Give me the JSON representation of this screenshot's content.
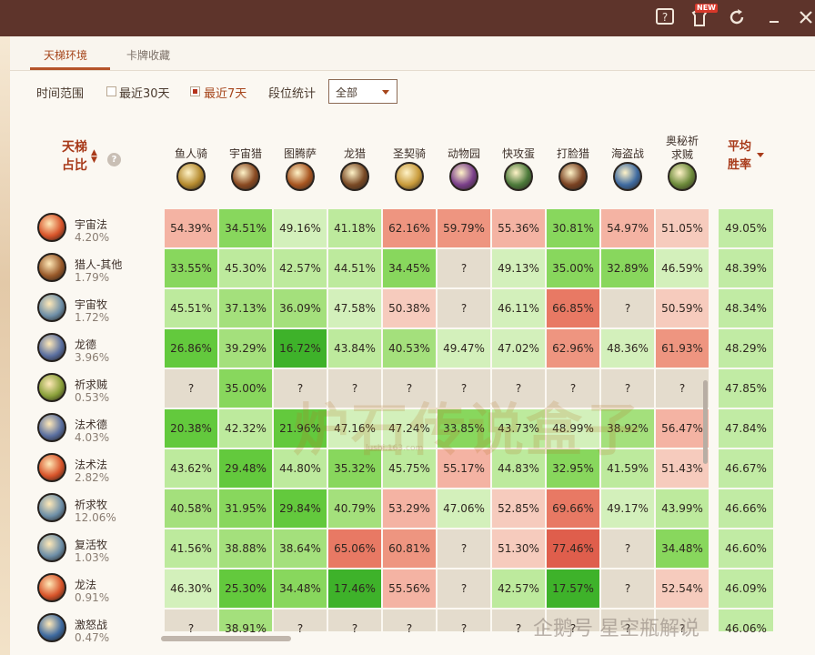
{
  "window": {
    "new_badge": "NEW",
    "icons": [
      "help-icon",
      "gift-icon",
      "refresh-icon",
      "minimize-icon",
      "close-icon"
    ]
  },
  "tabs": [
    {
      "label": "天梯环境",
      "active": true
    },
    {
      "label": "卡牌收藏",
      "active": false
    }
  ],
  "filters": {
    "time_range_label": "时间范围",
    "option_30": "最近30天",
    "option_7": "最近7天",
    "rank_label": "段位统计",
    "rank_value": "全部"
  },
  "table": {
    "left_header": "天梯占比",
    "avg_header": "平均胜率",
    "columns": [
      {
        "name": "鱼人骑",
        "color": "#b58a2e"
      },
      {
        "name": "宇宙猎",
        "color": "#8a4a22"
      },
      {
        "name": "图腾萨",
        "color": "#a85520"
      },
      {
        "name": "龙猎",
        "color": "#7a4a25"
      },
      {
        "name": "圣契骑",
        "color": "#c89a3a"
      },
      {
        "name": "动物园",
        "color": "#7a3f8a"
      },
      {
        "name": "快攻蛋",
        "color": "#4c7a3a"
      },
      {
        "name": "打脸猎",
        "color": "#7a4222"
      },
      {
        "name": "海盗战",
        "color": "#3e6aa0"
      },
      {
        "name": "奥秘祈求贼",
        "color": "#6c8a3a"
      }
    ],
    "rows": [
      {
        "name": "宇宙法",
        "share": "4.20%",
        "icon": "mage-icon",
        "color": "#d8542a",
        "cells": [
          "54.39%",
          "34.51%",
          "49.16%",
          "41.18%",
          "62.16%",
          "59.79%",
          "55.36%",
          "30.81%",
          "54.97%",
          "51.05%"
        ],
        "avg": "49.05%"
      },
      {
        "name": "猎人-其他",
        "share": "1.79%",
        "icon": "hunter-icon",
        "color": "#9a5a2a",
        "cells": [
          "33.55%",
          "45.30%",
          "42.57%",
          "44.51%",
          "34.45%",
          "?",
          "49.13%",
          "35.00%",
          "32.89%",
          "46.59%"
        ],
        "avg": "48.39%"
      },
      {
        "name": "宇宙牧",
        "share": "1.72%",
        "icon": "priest-icon",
        "color": "#6e8fa8",
        "cells": [
          "45.51%",
          "37.13%",
          "36.09%",
          "47.58%",
          "50.38%",
          "?",
          "46.11%",
          "66.85%",
          "?",
          "50.59%"
        ],
        "avg": "48.34%"
      },
      {
        "name": "龙德",
        "share": "3.96%",
        "icon": "druid-icon",
        "color": "#5a6fa0",
        "cells": [
          "26.86%",
          "39.29%",
          "16.72%",
          "43.84%",
          "40.53%",
          "49.47%",
          "47.02%",
          "62.96%",
          "48.36%",
          "61.93%"
        ],
        "avg": "48.29%"
      },
      {
        "name": "祈求贼",
        "share": "0.53%",
        "icon": "rogue-icon",
        "color": "#8aa03a",
        "cells": [
          "?",
          "35.00%",
          "?",
          "?",
          "?",
          "?",
          "?",
          "?",
          "?",
          "?"
        ],
        "avg": "47.85%"
      },
      {
        "name": "法术德",
        "share": "4.03%",
        "icon": "druid-icon",
        "color": "#5a6fa0",
        "cells": [
          "20.38%",
          "42.32%",
          "21.96%",
          "47.16%",
          "47.24%",
          "33.85%",
          "43.73%",
          "48.99%",
          "38.92%",
          "56.47%"
        ],
        "avg": "47.84%"
      },
      {
        "name": "法术法",
        "share": "2.82%",
        "icon": "mage-icon",
        "color": "#d8542a",
        "cells": [
          "43.62%",
          "29.48%",
          "44.80%",
          "35.32%",
          "45.75%",
          "55.17%",
          "44.83%",
          "32.95%",
          "41.59%",
          "51.43%"
        ],
        "avg": "46.67%"
      },
      {
        "name": "祈求牧",
        "share": "12.06%",
        "icon": "priest-icon",
        "color": "#6e8fa8",
        "cells": [
          "40.58%",
          "31.95%",
          "29.84%",
          "40.79%",
          "53.29%",
          "47.06%",
          "52.85%",
          "69.66%",
          "49.17%",
          "43.99%"
        ],
        "avg": "46.66%"
      },
      {
        "name": "复活牧",
        "share": "1.03%",
        "icon": "priest-icon",
        "color": "#6e8fa8",
        "cells": [
          "41.56%",
          "38.88%",
          "38.64%",
          "65.06%",
          "60.81%",
          "?",
          "51.30%",
          "77.46%",
          "?",
          "34.48%"
        ],
        "avg": "46.60%"
      },
      {
        "name": "龙法",
        "share": "0.91%",
        "icon": "mage-icon",
        "color": "#d8542a",
        "cells": [
          "46.30%",
          "25.30%",
          "34.48%",
          "17.46%",
          "55.56%",
          "?",
          "42.57%",
          "17.57%",
          "?",
          "52.54%"
        ],
        "avg": "46.09%"
      },
      {
        "name": "激怒战",
        "share": "0.47%",
        "icon": "warrior-icon",
        "color": "#3e6aa0",
        "cells": [
          "?",
          "38.91%",
          "?",
          "?",
          "?",
          "?",
          "?",
          "?",
          "?",
          "?"
        ],
        "avg": "46.06%"
      }
    ]
  },
  "watermark": {
    "main": "炉石传说盒子",
    "sub": "lushi.163.com",
    "footer": "企鹅号 星空瓶解说"
  }
}
